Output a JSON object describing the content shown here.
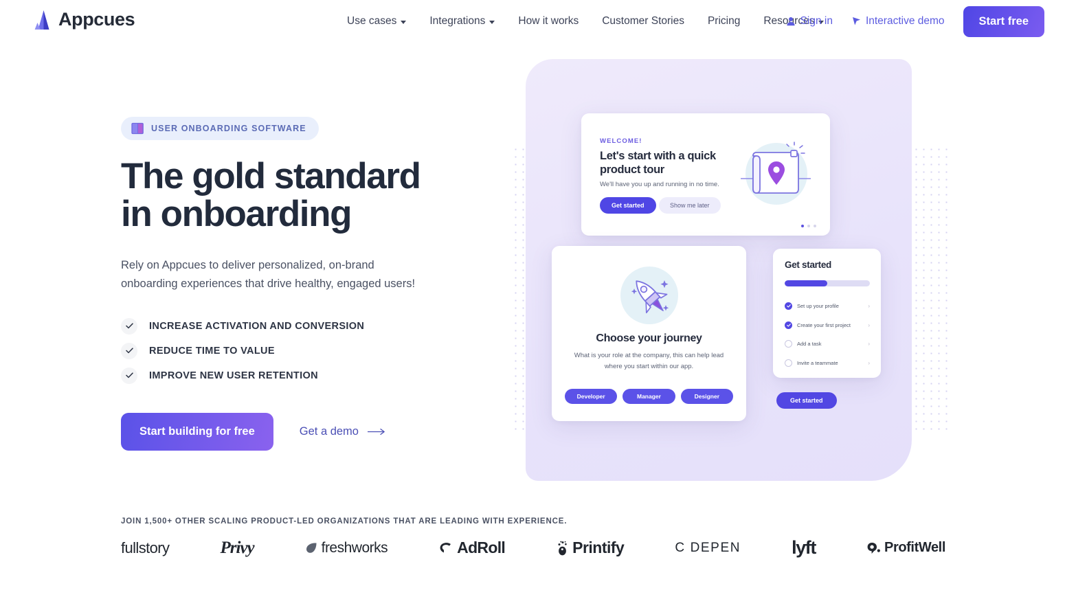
{
  "brand": {
    "name": "Appcues",
    "logo_icon": "appcues-triangle-logo",
    "accent": "#5c5ce0"
  },
  "nav": {
    "items": [
      {
        "label": "Use cases",
        "has_dropdown": true
      },
      {
        "label": "Integrations",
        "has_dropdown": true
      },
      {
        "label": "How it works",
        "has_dropdown": false
      },
      {
        "label": "Customer Stories",
        "has_dropdown": false
      },
      {
        "label": "Pricing",
        "has_dropdown": false
      },
      {
        "label": "Resources",
        "has_dropdown": true
      }
    ],
    "sign_in": {
      "label": "Sign in",
      "icon": "person-icon"
    },
    "interactive_demo": {
      "label": "Interactive demo",
      "icon": "cursor-arrow-icon"
    },
    "cta": {
      "label": "Start free"
    }
  },
  "hero": {
    "badge": {
      "label": "USER ONBOARDING SOFTWARE",
      "icon": "open-book-icon"
    },
    "headline_line1": "The gold standard",
    "headline_line2": "in onboarding",
    "subcopy": "Rely on Appcues to deliver personalized, on-brand onboarding experiences that drive healthy, engaged users!",
    "checklist": [
      {
        "label": "INCREASE ACTIVATION AND CONVERSION",
        "icon": "check-icon"
      },
      {
        "label": "REDUCE TIME TO VALUE",
        "icon": "check-icon"
      },
      {
        "label": "IMPROVE NEW USER RETENTION",
        "icon": "check-icon"
      }
    ],
    "primary_cta": "Start building for free",
    "secondary_cta": "Get a demo",
    "secondary_cta_icon": "arrow-right-icon"
  },
  "mockups": {
    "welcome_card": {
      "eyebrow": "WELCOME!",
      "title": "Let's start with a quick product tour",
      "subtitle": "We'll have you up and running in no time.",
      "primary_button": "Get started",
      "secondary_button": "Show me later",
      "illustration": "map-with-location-pin-icon",
      "pagination_dots": 3,
      "active_dot": 1
    },
    "journey_card": {
      "title": "Choose your journey",
      "subtitle": "What is your role at the company, this can help lead where you start within our app.",
      "illustration": "rocket-icon",
      "options": [
        "Developer",
        "Manager",
        "Designer"
      ]
    },
    "checklist_card": {
      "title": "Get started",
      "progress_percent": 50,
      "items": [
        {
          "label": "Set up your profile",
          "done": true
        },
        {
          "label": "Create your first project",
          "done": true
        },
        {
          "label": "Add a task",
          "done": false
        },
        {
          "label": "Invite a teammate",
          "done": false
        }
      ],
      "cta": "Get started"
    }
  },
  "social_proof": {
    "caption": "JOIN 1,500+ OTHER SCALING PRODUCT-LED ORGANIZATIONS THAT ARE LEADING WITH EXPERIENCE.",
    "logos": [
      {
        "name": "fullstory",
        "label": "fullstory"
      },
      {
        "name": "privy",
        "label": "Privy"
      },
      {
        "name": "freshworks",
        "label": "freshworks"
      },
      {
        "name": "adroll",
        "label": "AdRoll"
      },
      {
        "name": "printify",
        "label": "Printify"
      },
      {
        "name": "codepen",
        "label": "C DEPEN"
      },
      {
        "name": "lyft",
        "label": "lyft"
      },
      {
        "name": "profitwell",
        "label": "ProfitWell"
      }
    ]
  }
}
